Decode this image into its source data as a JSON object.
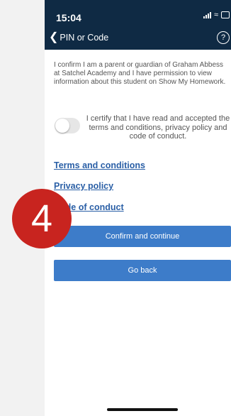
{
  "status_bar": {
    "time": "15:04"
  },
  "nav": {
    "back_icon": "chevron-left-icon",
    "title": "PIN or Code",
    "help_icon": "question-icon",
    "help_glyph": "?"
  },
  "consent_text": "I confirm I am a parent or guardian of Graham Abbess at Satchel Academy and I have permission to view information about this student on Show My Homework.",
  "certify": {
    "text": "I certify that I have read and accepted the terms and conditions, privacy policy and code of conduct.",
    "checked": false
  },
  "links": {
    "terms": "Terms and conditions",
    "privacy": "Privacy policy",
    "conduct": "Code of conduct"
  },
  "buttons": {
    "confirm": "Confirm and continue",
    "back": "Go back"
  },
  "overlay": {
    "step_number": "4"
  },
  "colors": {
    "header": "#0f2a44",
    "button": "#3d7cc9",
    "link": "#2a5fa6",
    "badge": "#c8241f"
  }
}
